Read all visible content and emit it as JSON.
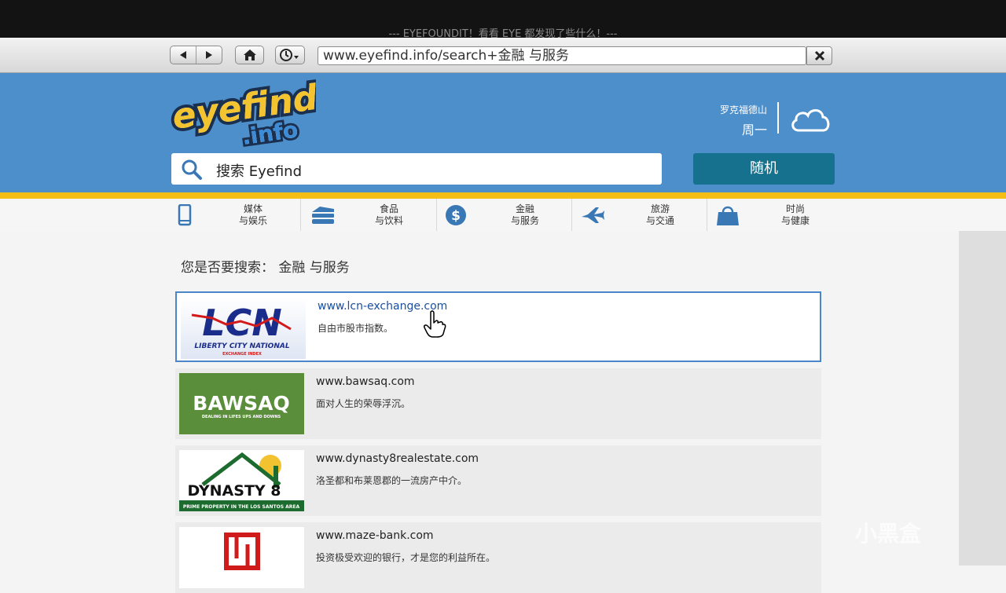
{
  "window": {
    "title": "--- EYEFOUNDIT！看看 EYE 都发现了些什么！---"
  },
  "browser": {
    "url": "www.eyefind.info/search+金融 与服务"
  },
  "header": {
    "logo_text_1": "eyefind",
    "logo_text_2": ".info",
    "location": "罗克福德山",
    "day": "周一",
    "search_placeholder": "搜索 Eyefind",
    "random_label": "随机"
  },
  "categories": [
    {
      "line1": "媒体",
      "line2": "与娱乐",
      "icon": "phone-icon"
    },
    {
      "line1": "食品",
      "line2": "与饮料",
      "icon": "burger-icon"
    },
    {
      "line1": "金融",
      "line2": "与服务",
      "icon": "dollar-icon"
    },
    {
      "line1": "旅游",
      "line2": "与交通",
      "icon": "plane-icon"
    },
    {
      "line1": "时尚",
      "line2": "与健康",
      "icon": "shopping-bag-icon"
    }
  ],
  "did_you_mean": "您是否要搜索： 金融 与服务",
  "results": [
    {
      "url": "www.lcn-exchange.com",
      "desc": "自由市股市指数。",
      "logo": {
        "main": "LCN",
        "sub": "LIBERTY CITY NATIONAL",
        "sub2": "EXCHANGE INDEX"
      }
    },
    {
      "url": "www.bawsaq.com",
      "desc": "面对人生的荣辱浮沉。",
      "logo": {
        "main": "BAWSAQ",
        "sub": "DEALING IN LIFES UPS AND DOWNS"
      }
    },
    {
      "url": "www.dynasty8realestate.com",
      "desc": "洛圣都和布莱恩郡的一流房产中介。",
      "logo": {
        "main": "DYNASTY 8",
        "sub": "PRIME PROPERTY IN THE LOS SANTOS AREA"
      }
    },
    {
      "url": "www.maze-bank.com",
      "desc": "投资极受欢迎的银行，才是您的利益所在。"
    }
  ],
  "watermark": "小黑盒",
  "colors": {
    "header_blue": "#4d8fca",
    "accent_gold": "#f4be14",
    "button_teal": "#16718f",
    "active_border": "#4a86c9"
  }
}
